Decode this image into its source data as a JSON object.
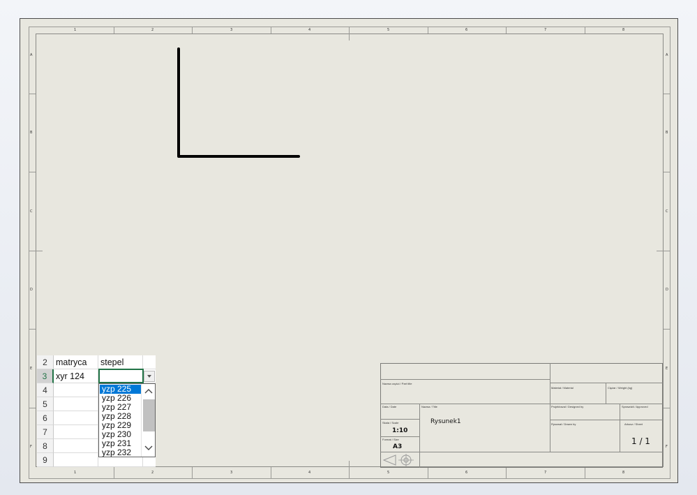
{
  "zone_labels": {
    "top": [
      "1",
      "2",
      "3",
      "4",
      "5",
      "6",
      "7",
      "8"
    ],
    "bottom": [
      "1",
      "2",
      "3",
      "4",
      "5",
      "6",
      "7",
      "8"
    ],
    "left": [
      "A",
      "B",
      "C",
      "D",
      "E",
      "F"
    ],
    "right": [
      "A",
      "B",
      "C",
      "D",
      "E",
      "F"
    ]
  },
  "title_block": {
    "part_name_label": "Nazwa części / Part title",
    "material_label": "Materiał / Material",
    "weight_label": "Ciężar / Weight (kg)",
    "date_label": "Data / Date",
    "name_label": "Nazwa / Title",
    "designed_label": "Projektował / Designed by",
    "approved_label": "Sprawdził / Approved",
    "scale_label": "Skala / Scale",
    "scale_value": "1:10",
    "format_label": "Format / Size",
    "format_value": "A3",
    "drawn_label": "Rysował / Drawn by",
    "sheet_label": "Arkusz / Sheet",
    "drawing_name": "Rysunek1",
    "sheet_value": "1 / 1"
  },
  "spreadsheet": {
    "rows": [
      {
        "num": "2",
        "a": "matryca",
        "b": "stepel"
      },
      {
        "num": "3",
        "a": "xyr 124",
        "b": ""
      },
      {
        "num": "4",
        "a": "",
        "b": ""
      },
      {
        "num": "5",
        "a": "",
        "b": ""
      },
      {
        "num": "6",
        "a": "",
        "b": ""
      },
      {
        "num": "7",
        "a": "",
        "b": ""
      },
      {
        "num": "8",
        "a": "",
        "b": ""
      },
      {
        "num": "9",
        "a": "",
        "b": ""
      }
    ],
    "dropdown_options": [
      "yzp 225",
      "yzp 226",
      "yzp 227",
      "yzp 228",
      "yzp 229",
      "yzp 230",
      "yzp 231",
      "yzp 232"
    ],
    "highlighted_option": "yzp 225"
  },
  "icons": [
    "dropdown-arrow-icon",
    "scroll-up-icon",
    "scroll-down-icon",
    "projection-symbol-icon"
  ]
}
